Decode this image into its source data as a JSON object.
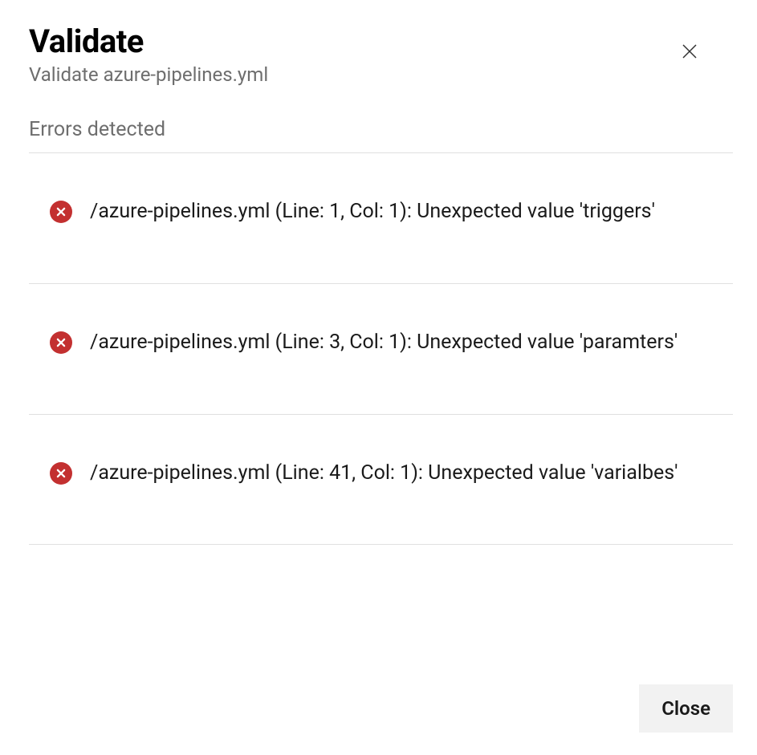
{
  "header": {
    "title": "Validate",
    "subtitle": "Validate azure-pipelines.yml"
  },
  "section_label": "Errors detected",
  "errors": [
    {
      "message": "/azure-pipelines.yml (Line: 1, Col: 1): Unexpected value 'triggers'"
    },
    {
      "message": "/azure-pipelines.yml (Line: 3, Col: 1): Unexpected value 'paramters'"
    },
    {
      "message": "/azure-pipelines.yml (Line: 41, Col: 1): Unexpected value 'varialbes'"
    }
  ],
  "footer": {
    "close_label": "Close"
  }
}
